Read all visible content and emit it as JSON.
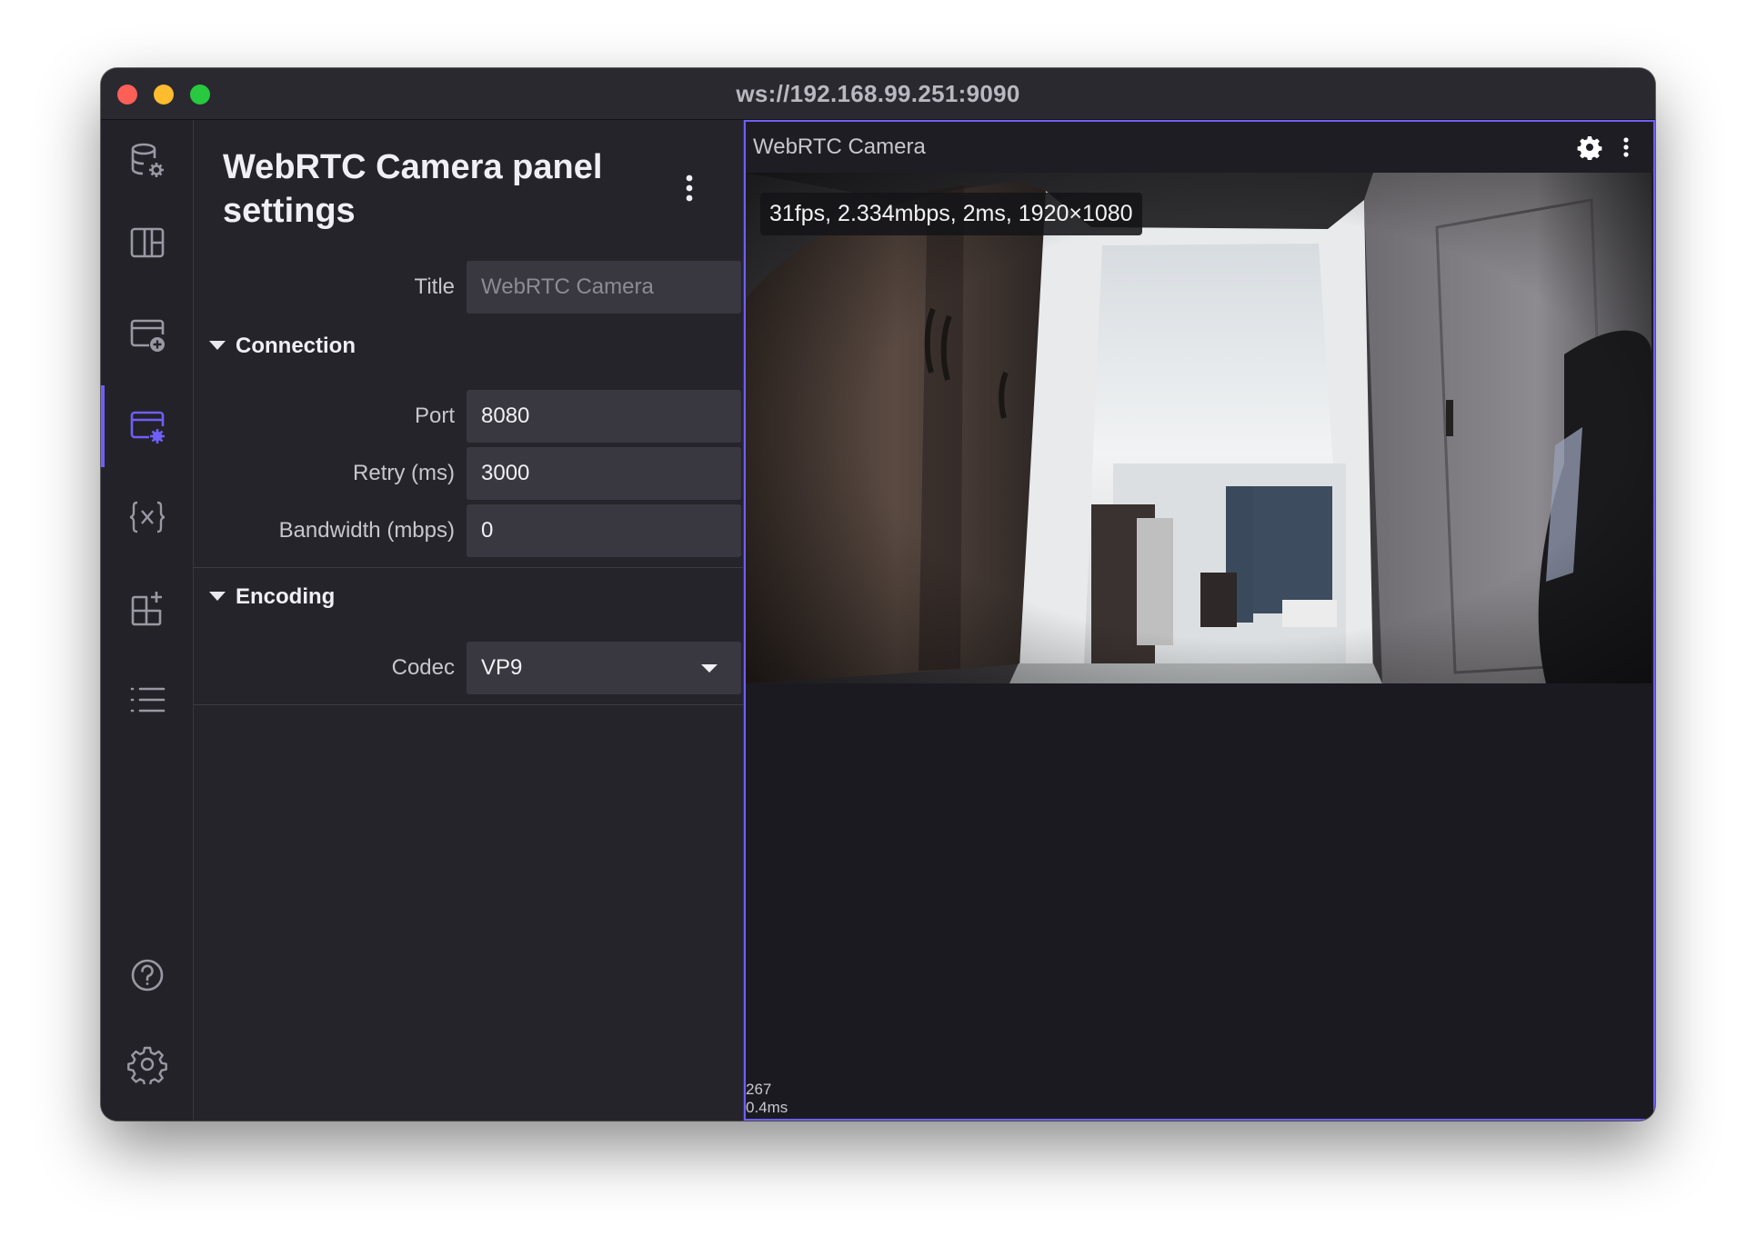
{
  "window": {
    "title": "ws://192.168.99.251:9090"
  },
  "sidebar": {
    "items": [
      {
        "name": "data-source-settings",
        "icon": "database-gear-icon"
      },
      {
        "name": "layouts",
        "icon": "layout-icon"
      },
      {
        "name": "add-panel",
        "icon": "add-panel-icon"
      },
      {
        "name": "panel-settings",
        "icon": "panel-settings-icon",
        "active": true
      },
      {
        "name": "variables",
        "icon": "variables-icon"
      },
      {
        "name": "extensions",
        "icon": "extensions-icon"
      },
      {
        "name": "problems",
        "icon": "list-icon"
      }
    ],
    "bottom_items": [
      {
        "name": "help",
        "icon": "help-icon"
      },
      {
        "name": "app-settings",
        "icon": "gear-icon"
      }
    ]
  },
  "settings": {
    "heading": "WebRTC Camera panel settings",
    "title_label": "Title",
    "title_placeholder": "WebRTC Camera",
    "connection": {
      "heading": "Connection",
      "port_label": "Port",
      "port_value": "8080",
      "retry_label": "Retry (ms)",
      "retry_value": "3000",
      "bandwidth_label": "Bandwidth (mbps)",
      "bandwidth_value": "0"
    },
    "encoding": {
      "heading": "Encoding",
      "codec_label": "Codec",
      "codec_value": "VP9"
    }
  },
  "panel": {
    "title": "WebRTC Camera",
    "stats": "31fps, 2.334mbps, 2ms, 1920×1080",
    "perf_count": "267",
    "perf_time": "0.4ms"
  },
  "colors": {
    "accent": "#6f5ff7",
    "window_bg": "#1c1b22",
    "sidebar_bg": "#232229",
    "settings_bg": "#25242b",
    "field_bg": "#393840"
  }
}
